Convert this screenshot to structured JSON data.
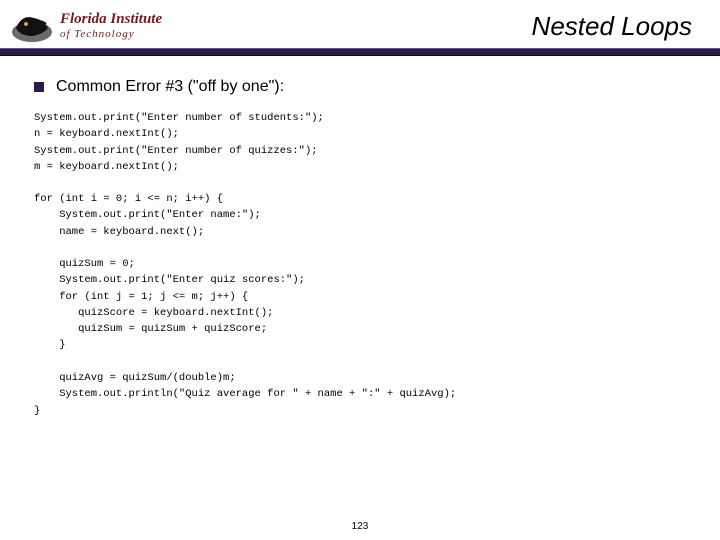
{
  "header": {
    "inst_line1": "Florida Institute",
    "inst_line2": "of Technology",
    "title": "Nested Loops"
  },
  "bullet": {
    "text": "Common Error #3 (\"off by one\"):"
  },
  "code": {
    "block1": "System.out.print(\"Enter number of students:\");\nn = keyboard.nextInt();\nSystem.out.print(\"Enter number of quizzes:\");\nm = keyboard.nextInt();",
    "block2": "for (int i = 0; i <= n; i++) {\n    System.out.print(\"Enter name:\");\n    name = keyboard.next();\n\n    quizSum = 0;\n    System.out.print(\"Enter quiz scores:\");\n    for (int j = 1; j <= m; j++) {\n       quizScore = keyboard.nextInt();\n       quizSum = quizSum + quizScore;\n    }\n\n    quizAvg = quizSum/(double)m;\n    System.out.println(\"Quiz average for \" + name + \":\" + quizAvg);\n}"
  },
  "page_number": "123"
}
